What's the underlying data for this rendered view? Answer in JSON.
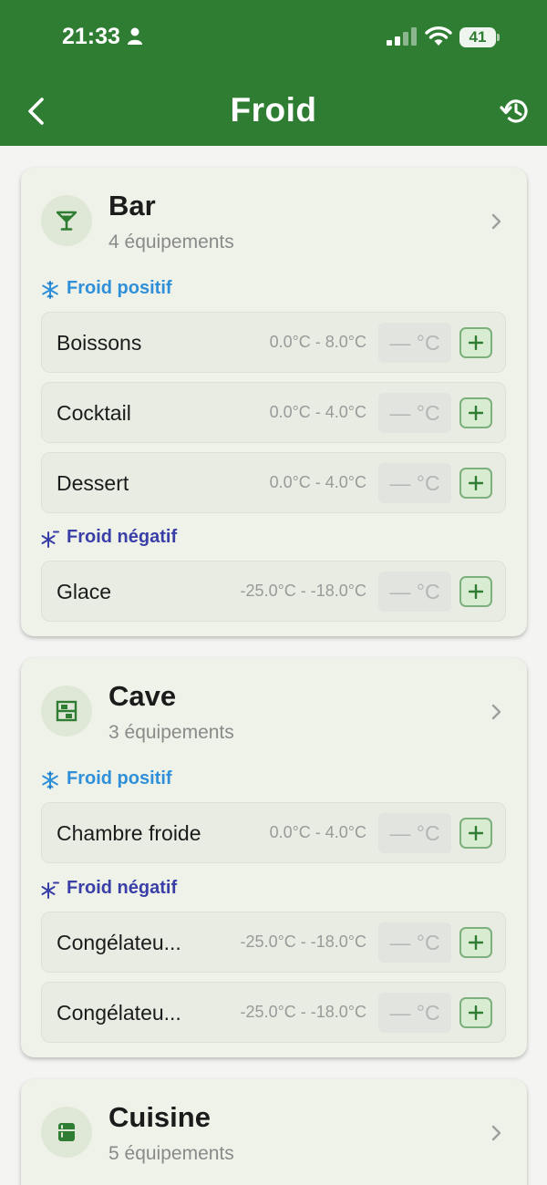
{
  "status_bar": {
    "time": "21:33",
    "battery": "41"
  },
  "nav": {
    "title": "Froid"
  },
  "cards": [
    {
      "title": "Bar",
      "subtitle": "4 équipements",
      "sections": [
        {
          "label": "Froid positif",
          "items": [
            {
              "name": "Boissons",
              "range": "0.0°C - 8.0°C",
              "temp": "— °C"
            },
            {
              "name": "Cocktail",
              "range": "0.0°C - 4.0°C",
              "temp": "— °C"
            },
            {
              "name": "Dessert",
              "range": "0.0°C - 4.0°C",
              "temp": "— °C"
            }
          ]
        },
        {
          "label": "Froid négatif",
          "items": [
            {
              "name": "Glace",
              "range": "-25.0°C - -18.0°C",
              "temp": "— °C"
            }
          ]
        }
      ]
    },
    {
      "title": "Cave",
      "subtitle": "3 équipements",
      "sections": [
        {
          "label": "Froid positif",
          "items": [
            {
              "name": "Chambre froide",
              "range": "0.0°C - 4.0°C",
              "temp": "— °C"
            }
          ]
        },
        {
          "label": "Froid négatif",
          "items": [
            {
              "name": "Congélateu...",
              "range": "-25.0°C - -18.0°C",
              "temp": "— °C"
            },
            {
              "name": "Congélateu...",
              "range": "-25.0°C - -18.0°C",
              "temp": "— °C"
            }
          ]
        }
      ]
    },
    {
      "title": "Cuisine",
      "subtitle": "5 équipements"
    }
  ],
  "colors": {
    "header_green": "#2e7d32",
    "positive_blue": "#2f8fd9",
    "negative_indigo": "#3a3fa8",
    "card_bg": "#eef2e8"
  },
  "icons": {
    "back": "chevron-left-icon",
    "history": "history-icon",
    "bar": "cocktail-glass-icon",
    "cave": "shelving-icon",
    "cuisine": "fridge-icon",
    "positive": "snowflake-icon",
    "negative": "snowflake-minus-icon",
    "add": "plus-icon"
  }
}
